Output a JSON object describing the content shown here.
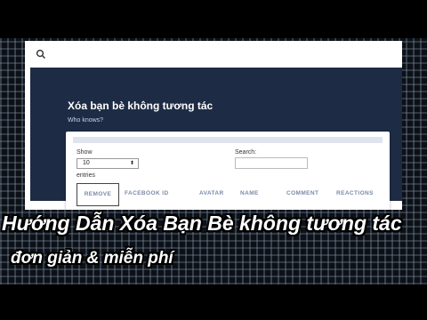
{
  "app": {
    "title": "Xóa bạn bè không tương tác",
    "subtitle": "Who knows?"
  },
  "table_controls": {
    "show_label": "Show",
    "entries_value": "10",
    "entries_suffix": "entries",
    "search_label": "Search:",
    "search_value": ""
  },
  "table": {
    "columns": [
      "REMOVE",
      "FACEBOOK ID",
      "AVATAR",
      "NAME",
      "COMMENT",
      "REACTIONS"
    ]
  },
  "overlay": {
    "line1": "Hướng Dẫn Xóa Bạn Bè không tương tác",
    "line2": "đơn giản & miễn phí"
  },
  "colors": {
    "hero_bg": "#1e2b45",
    "header_text": "#7a8aa8"
  }
}
